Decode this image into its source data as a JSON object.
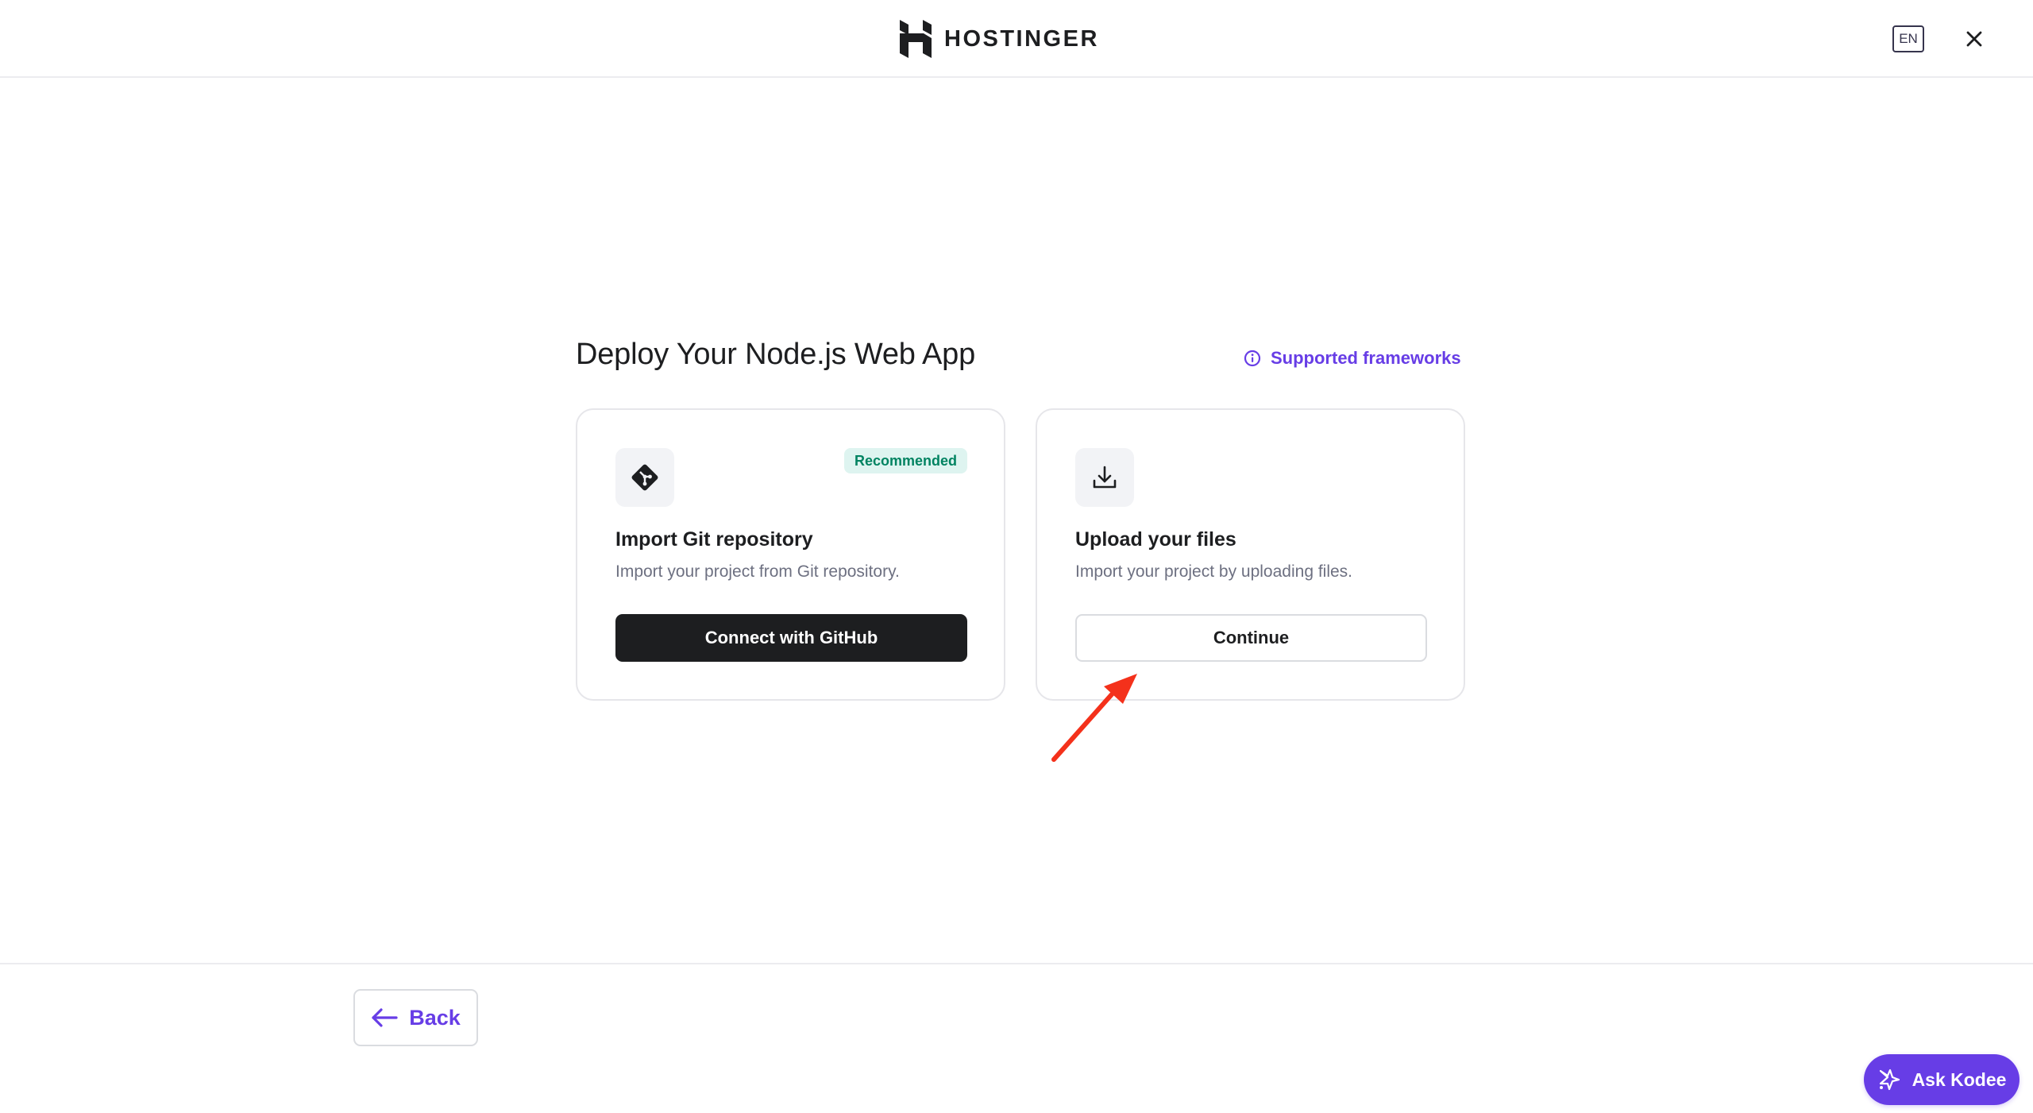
{
  "header": {
    "brand": "HOSTINGER",
    "language": "EN",
    "close_icon": "close-icon"
  },
  "main": {
    "title": "Deploy Your Node.js Web App",
    "frameworks_link": "Supported frameworks",
    "frameworks_icon": "info-icon",
    "cards": [
      {
        "icon": "git-icon",
        "badge": "Recommended",
        "title": "Import Git repository",
        "description": "Import your project from Git repository.",
        "button": "Connect with GitHub"
      },
      {
        "icon": "download-icon",
        "title": "Upload your files",
        "description": "Import your project by uploading files.",
        "button": "Continue"
      }
    ]
  },
  "footer": {
    "back_label": "Back",
    "back_icon": "arrow-left-icon"
  },
  "assistant": {
    "label": "Ask Kodee",
    "icon": "kodee-icon"
  },
  "colors": {
    "accent": "#673de6",
    "dark_button": "#1d1e20",
    "badge_bg": "#def4f0",
    "badge_text": "#008361",
    "annotation_arrow": "#f4311b"
  }
}
